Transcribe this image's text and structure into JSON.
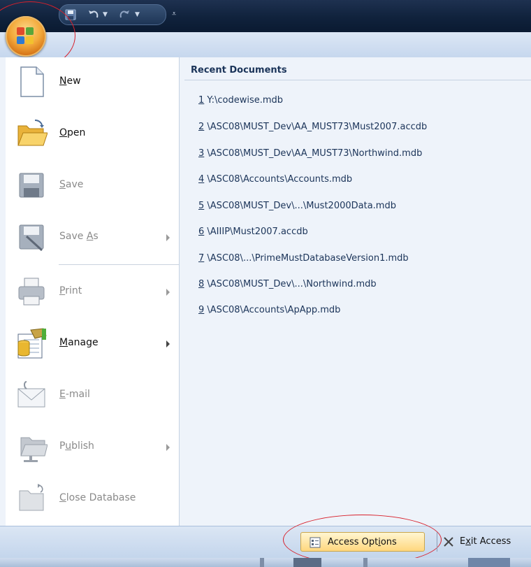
{
  "titlebar": {
    "qat_undo_icon": "undo-icon",
    "qat_redo_icon": "redo-icon",
    "qat_save_icon": "save-icon",
    "customize_glyph": "⩡"
  },
  "office_button": {
    "icon": "office-logo"
  },
  "menu": {
    "items": [
      {
        "name": "new",
        "label_ul": "N",
        "label_rest": "ew",
        "icon": "new-document-icon",
        "enabled": true,
        "submenu": false
      },
      {
        "name": "open",
        "label_ul": "O",
        "label_rest": "pen",
        "icon": "open-folder-icon",
        "enabled": true,
        "submenu": false
      },
      {
        "name": "save",
        "label_ul": "S",
        "label_rest": "ave",
        "icon": "save-disk-icon",
        "enabled": false,
        "submenu": false
      },
      {
        "name": "save-as",
        "label_pre": "Save ",
        "label_ul": "A",
        "label_rest": "s",
        "icon": "save-as-icon",
        "enabled": false,
        "submenu": true
      },
      {
        "name": "print",
        "label_ul": "P",
        "label_rest": "rint",
        "icon": "printer-icon",
        "enabled": false,
        "submenu": true
      },
      {
        "name": "manage",
        "label_ul": "M",
        "label_rest": "anage",
        "icon": "manage-database-icon",
        "enabled": true,
        "submenu": true
      },
      {
        "name": "email",
        "label_ul": "E",
        "label_rest": "-mail",
        "icon": "email-icon",
        "enabled": false,
        "submenu": false
      },
      {
        "name": "publish",
        "label_pre": "P",
        "label_ul": "u",
        "label_rest": "blish",
        "icon": "publish-icon",
        "enabled": false,
        "submenu": true
      },
      {
        "name": "close-database",
        "label_ul": "C",
        "label_rest": "lose Database",
        "icon": "close-database-icon",
        "enabled": false,
        "submenu": false
      }
    ]
  },
  "recent": {
    "title": "Recent Documents",
    "items": [
      {
        "num": "1",
        "path": " Y:\\codewise.mdb"
      },
      {
        "num": "2",
        "path": " \\ASC08\\MUST_Dev\\AA_MUST73\\Must2007.accdb"
      },
      {
        "num": "3",
        "path": " \\ASC08\\MUST_Dev\\AA_MUST73\\Northwind.mdb"
      },
      {
        "num": "4",
        "path": " \\ASC08\\Accounts\\Accounts.mdb"
      },
      {
        "num": "5",
        "path": " \\ASC08\\MUST_Dev\\...\\Must2000Data.mdb"
      },
      {
        "num": "6",
        "path": " \\AIIIP\\Must2007.accdb"
      },
      {
        "num": "7",
        "path": " \\ASC08\\...\\PrimeMustDatabaseVersion1.mdb"
      },
      {
        "num": "8",
        "path": " \\ASC08\\MUST_Dev\\...\\Northwind.mdb"
      },
      {
        "num": "9",
        "path": " \\ASC08\\Accounts\\ApApp.mdb"
      }
    ]
  },
  "footer": {
    "options": {
      "pre": "Access Opt",
      "ul": "i",
      "rest": "ons",
      "icon": "options-icon"
    },
    "exit": {
      "pre": "E",
      "ul": "x",
      "rest": "it Access",
      "icon": "exit-x-icon"
    }
  },
  "colors": {
    "annotation_red": "#d8202b",
    "accent_orange": "#f3a93a",
    "link_blue": "#1b3459"
  }
}
